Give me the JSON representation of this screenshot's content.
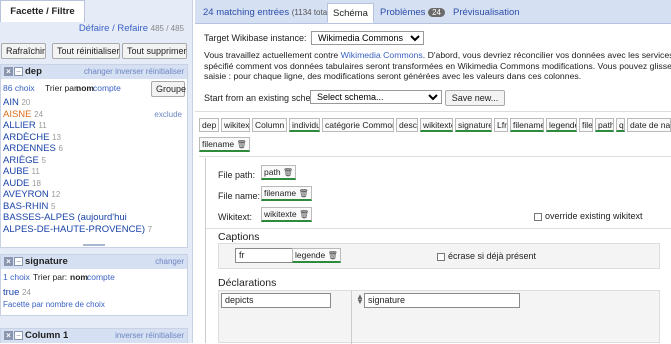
{
  "left": {
    "tab_label": "Facette / Filtre",
    "undo_label": "Défaire / Refaire",
    "undo_count": "485 / 485",
    "buttons": [
      "Rafraîchir",
      "Tout réinitialiser",
      "Tout supprimer"
    ]
  },
  "facet_dep": {
    "title": "dep",
    "actions": [
      "changer",
      "inverser",
      "réinitialiser"
    ],
    "choices_count": "86 choix",
    "sort_label": "Trier par:",
    "sort_name": "nom",
    "sort_count": "compte",
    "group_button": "Groupe",
    "exclude_label": "exclude",
    "items": [
      {
        "name": "AIN",
        "count": "20"
      },
      {
        "name": "AISNE",
        "count": "24"
      },
      {
        "name": "ALLIER",
        "count": "11"
      },
      {
        "name": "ARDÈCHE",
        "count": "13"
      },
      {
        "name": "ARDENNES",
        "count": "6"
      },
      {
        "name": "ARIÈGE",
        "count": "5"
      },
      {
        "name": "AUBE",
        "count": "11"
      },
      {
        "name": "AUDE",
        "count": "18"
      },
      {
        "name": "AVEYRON",
        "count": "12"
      },
      {
        "name": "BAS-RHIN",
        "count": "5"
      },
      {
        "name": "BASSES-ALPES (aujourd'hui",
        "count": ""
      },
      {
        "name": "ALPES-DE-HAUTE-PROVENCE)",
        "count": "7"
      }
    ]
  },
  "facet_signature": {
    "title": "signature",
    "action": "changer",
    "choices_count": "1 choix",
    "sort_label": "Trier par:",
    "sort_name": "nom",
    "sort_count": "compte",
    "item_name": "true",
    "item_count": "24",
    "facet_by_count": "Facette par nombre de choix"
  },
  "facet_column1": {
    "title": "Column 1",
    "actions": [
      "inverser",
      "réinitialiser"
    ]
  },
  "tabs": {
    "matching": "24 matching entrées",
    "matching_total": "(1134 total)",
    "schema": "Schéma",
    "problems": "Problèmes",
    "problems_count": "24",
    "preview": "Prévisualisation"
  },
  "schema": {
    "instance_label": "Target Wikibase instance:",
    "instance_value": "Wikimedia Commons",
    "intro_pre": "Vous travaillez actuellement contre ",
    "intro_link": "Wikimedia Commons",
    "intro_post": ". D'abord, vous devriez réconcilier vos données avec les services de réconcilia",
    "intro_line2": "spécifié comment vos données tabulaires seront transformées en Wikimedia Commons modifications. Vous pouvez glisser-déposer les",
    "intro_line3": "saisie : pour chaque ligne, des modifications seront générées avec les valeurs dans ces colonnes.",
    "start_label": "Start from an existing schema:",
    "select_placeholder": "Select schema...",
    "save_new": "Save new...",
    "columns": [
      "dep",
      "wikitext",
      "Column 1",
      "individu",
      "catégorie Commons",
      "desc",
      "wikitexte",
      "signature",
      "Lfr",
      "filename",
      "legende",
      "file",
      "path",
      "q",
      "date de nais"
    ],
    "filename_chip": "filename",
    "file_path_label": "File path:",
    "file_path_value": "path",
    "file_name_label": "File name:",
    "file_name_value": "filename",
    "wikitext_label": "Wikitext:",
    "wikitext_value": "wikitexte",
    "override_label": "override existing wikitext",
    "captions_heading": "Captions",
    "caption_lang": "fr",
    "caption_value": "legende",
    "overwrite_label": "écrase si déjà présent",
    "declarations_heading": "Déclarations",
    "property": "depicts",
    "value": "signature"
  },
  "colors": {
    "accent": "#2c4ea8",
    "selected": "#e06c1c",
    "used": "#2e8b3d",
    "panel": "#e5ebf7"
  }
}
